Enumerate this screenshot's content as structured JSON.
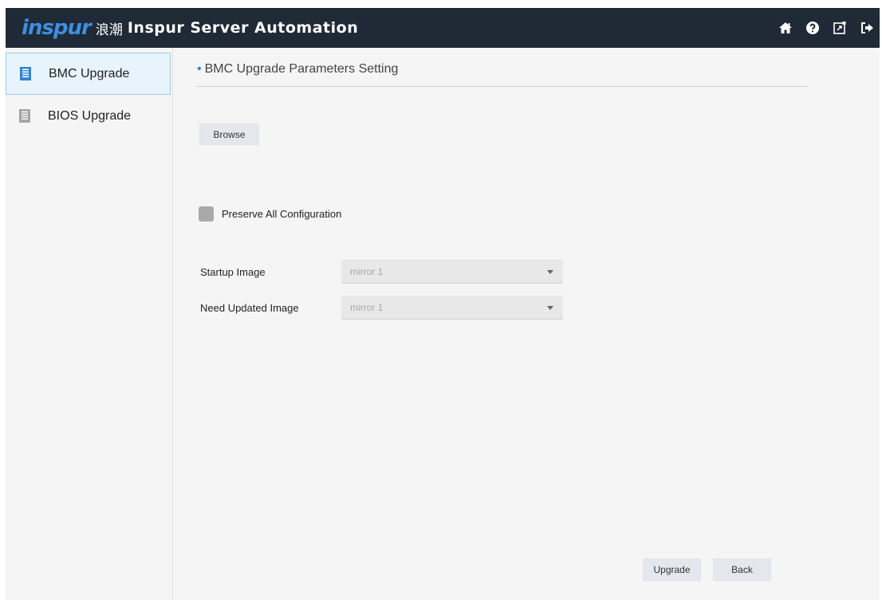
{
  "header": {
    "logo_text": "inspur",
    "brand_cn": "浪潮",
    "title": "Inspur Server Automation",
    "icons": [
      "home-icon",
      "help-icon",
      "export-icon",
      "logout-icon"
    ]
  },
  "sidebar": {
    "items": [
      {
        "label": "BMC Upgrade",
        "active": true,
        "icon": "server-module-icon"
      },
      {
        "label": "BIOS Upgrade",
        "active": false,
        "icon": "server-module-icon"
      }
    ]
  },
  "main": {
    "section_title": "BMC Upgrade Parameters Setting",
    "browse_label": "Browse",
    "preserve_label": "Preserve All Configuration",
    "startup_image_label": "Startup Image",
    "startup_image_value": "mirror 1",
    "need_updated_label": "Need Updated Image",
    "need_updated_value": "mirror 1",
    "upgrade_label": "Upgrade",
    "back_label": "Back"
  },
  "colors": {
    "topbar": "#1f2a36",
    "accent": "#3d8fe0",
    "active_item_bg": "#e8f4fd",
    "active_item_border": "#9ccbec"
  }
}
